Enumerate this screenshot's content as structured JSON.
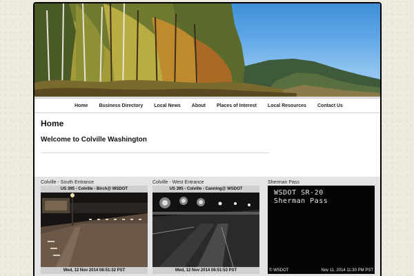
{
  "nav": {
    "items": [
      {
        "label": "Home"
      },
      {
        "label": "Business Directory"
      },
      {
        "label": "Local News"
      },
      {
        "label": "About"
      },
      {
        "label": "Places of Interest"
      },
      {
        "label": "Local Resources"
      },
      {
        "label": "Contact Us"
      }
    ]
  },
  "main": {
    "page_title": "Home",
    "welcome": "Welcome to Colville Washington"
  },
  "cameras": [
    {
      "title": "Colville - South Entrance",
      "caption_top": "US 395 - Colville - Birch@ WSDOT",
      "caption_bottom": "Wed, 12 Nov 2014 08:51:32 PST"
    },
    {
      "title": "Colville - West Entrance",
      "caption_top": "US 395 - Colville - Canning@ WSDOT",
      "caption_bottom": "Wed, 12 Nov 2014 08:51:53 PST"
    },
    {
      "title": "Sherman Pass",
      "line1": "WSDOT SR-20",
      "line2": "Sherman Pass",
      "foot_left": "© WSDOT",
      "foot_right": "Nov 11, 2014 11:30 PM PST"
    }
  ],
  "colors": {
    "page_bg": "#efebe0",
    "frame": "#000000",
    "cam_panel_bg": "#e4e4e4"
  }
}
